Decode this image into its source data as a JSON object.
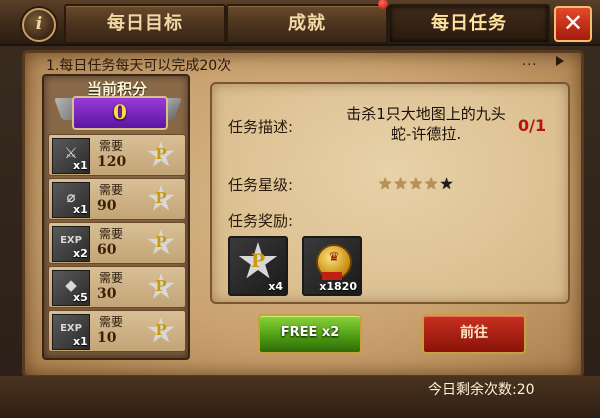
{
  "header": {
    "info_label": "i",
    "tabs": [
      {
        "label": "每日目标",
        "active": false
      },
      {
        "label": "成就",
        "active": false
      },
      {
        "label": "每日任务",
        "active": true
      }
    ],
    "close_label": "✕"
  },
  "headline": "1.每日任务每天可以完成20次",
  "more_dots": "...",
  "score": {
    "title": "当前积分",
    "value": "0"
  },
  "rewards": [
    {
      "icon": "warrior-icon",
      "glyph": "⚔",
      "qty": "x1",
      "need": "需要",
      "cost": "120"
    },
    {
      "icon": "ring-icon",
      "glyph": "⌀",
      "qty": "x1",
      "need": "需要",
      "cost": "90"
    },
    {
      "icon": "exp-scroll-icon",
      "glyph": "EXP",
      "qty": "x2",
      "need": "需要",
      "cost": "60"
    },
    {
      "icon": "stone-icon",
      "glyph": "◆",
      "qty": "x5",
      "need": "需要",
      "cost": "30"
    },
    {
      "icon": "exp-scroll-icon",
      "glyph": "EXP",
      "qty": "x1",
      "need": "需要",
      "cost": "10"
    }
  ],
  "task": {
    "desc_label": "任务描述:",
    "desc_text": "击杀1只大地图上的九头蛇-许德拉.",
    "progress": "0/1",
    "star_label": "任务星级:",
    "stars_total": 5,
    "stars_filled": 4,
    "reward_label": "任务奖励:",
    "rewards": [
      {
        "icon": "p-point-icon",
        "glyph": "P",
        "count": "x4"
      },
      {
        "icon": "gold-medal-icon",
        "glyph": "♛",
        "count": "x1820"
      }
    ]
  },
  "buttons": {
    "free": "FREE  x2",
    "go": "前往"
  },
  "remaining": "今日剩余次数:20",
  "colors": {
    "accent_gold": "#ffd940",
    "progress_red": "#b8140c",
    "free_green": "#4a9a10",
    "go_red": "#a8200f"
  }
}
